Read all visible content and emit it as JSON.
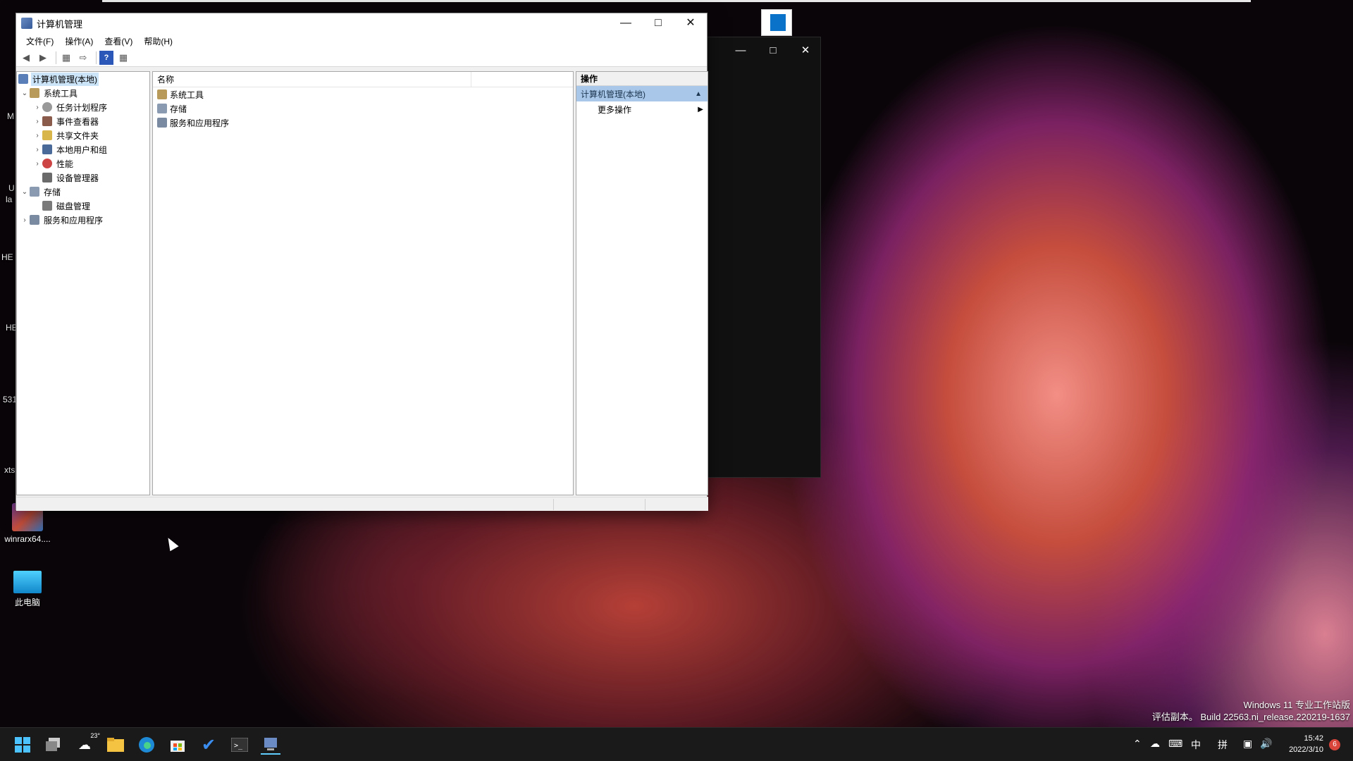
{
  "desktop": {
    "icons": [
      {
        "label": "winrarx64....",
        "icon": "winrar-archive-icon"
      },
      {
        "label": "此电脑",
        "icon": "this-pc-icon"
      }
    ],
    "partial_labels": [
      "M",
      "U",
      "la",
      "HE",
      "HE",
      "531",
      "xts"
    ]
  },
  "window": {
    "title": "计算机管理",
    "menu": [
      "文件(F)",
      "操作(A)",
      "查看(V)",
      "帮助(H)"
    ],
    "toolbar_icons": [
      "back-icon",
      "forward-icon",
      "show-hide-tree-icon",
      "export-list-icon",
      "help-icon",
      "properties-icon"
    ],
    "tree": {
      "root": "计算机管理(本地)",
      "system_tools": "系统工具",
      "system_tools_children": [
        "任务计划程序",
        "事件查看器",
        "共享文件夹",
        "本地用户和组",
        "性能",
        "设备管理器"
      ],
      "storage": "存储",
      "storage_children": [
        "磁盘管理"
      ],
      "services": "服务和应用程序"
    },
    "list": {
      "column_name": "名称",
      "items": [
        "系统工具",
        "存储",
        "服务和应用程序"
      ]
    },
    "actions": {
      "header": "操作",
      "selected": "计算机管理(本地)",
      "more": "更多操作"
    }
  },
  "taskbar": {
    "weather_temp": "23°",
    "ime_mode": "中",
    "ime_layout": "拼",
    "time": "15:42",
    "date": "2022/3/10",
    "notification_count": "6"
  },
  "watermark": {
    "line1": "Windows 11 专业工作站版",
    "line2": "评估副本。 Build 22563.ni_release.220219-1637"
  },
  "colors": {
    "selection": "#cce4f7",
    "action_header": "#a9c7e8",
    "taskbar": "#1a1a1a"
  }
}
